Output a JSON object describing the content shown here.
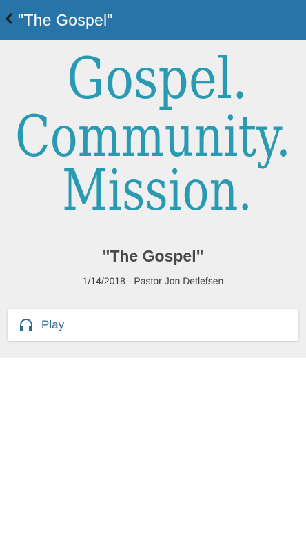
{
  "header": {
    "title": "\"The Gospel\"",
    "back_icon": "chevron-left-icon",
    "background_color": "#2775a8"
  },
  "hero": {
    "line1": "Gospel.",
    "line2": "Community.",
    "line3": "Mission.",
    "text_color": "#2a9ab3"
  },
  "sermon": {
    "title": "\"The Gospel\"",
    "meta": "1/14/2018 - Pastor Jon Detlefsen"
  },
  "actions": {
    "play_label": "Play",
    "play_icon": "headphones-icon"
  }
}
